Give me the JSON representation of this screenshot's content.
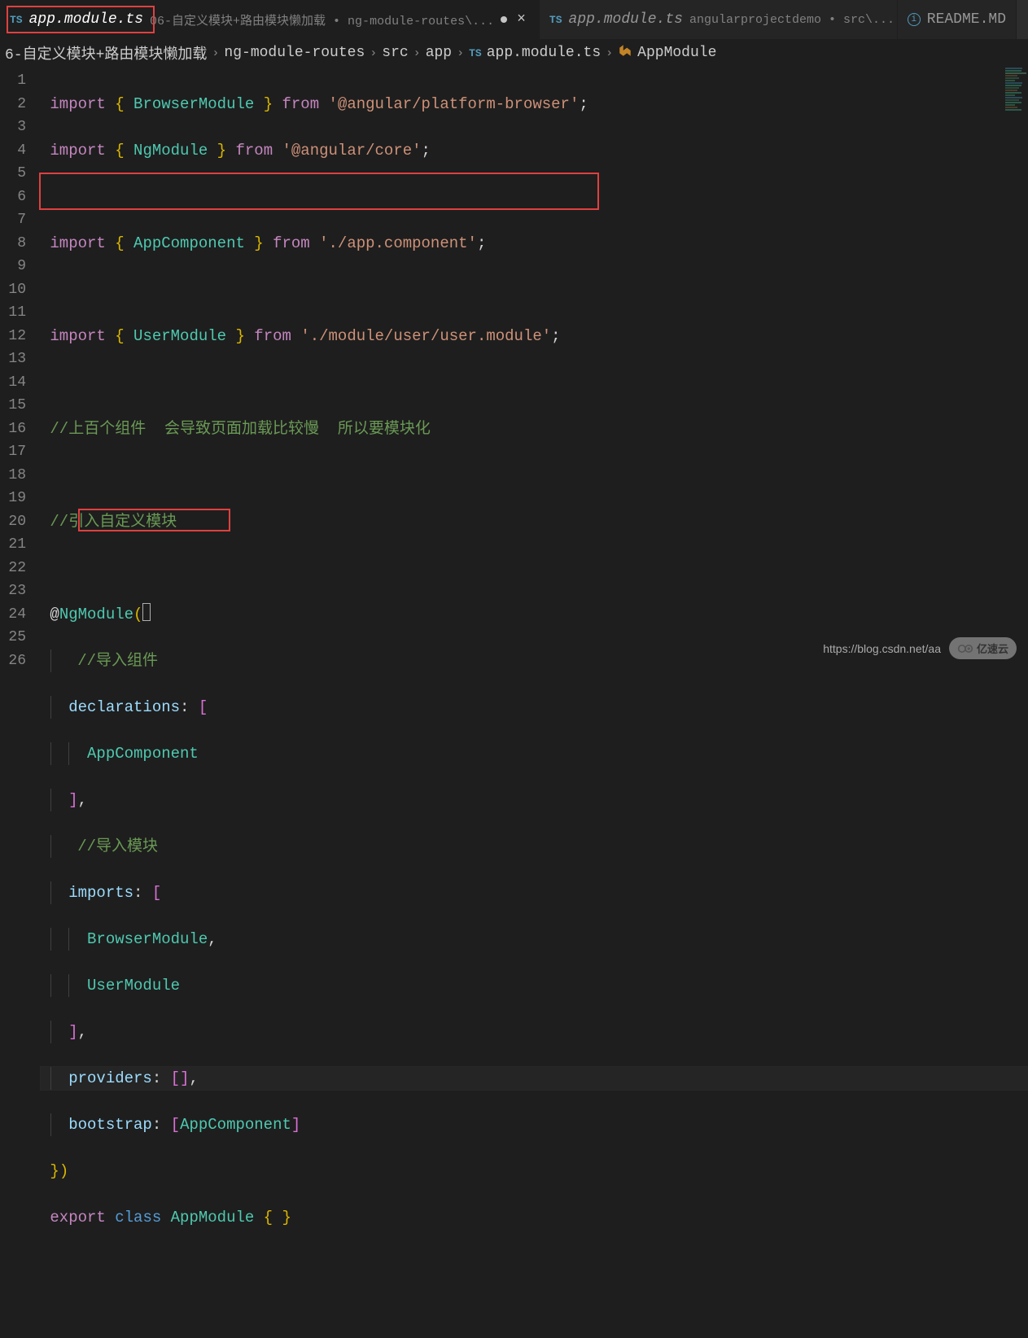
{
  "tabs": [
    {
      "file": "app.module.ts",
      "path": "06-自定义模块+路由模块懒加载 • ng-module-routes\\...",
      "active": true,
      "dirty": true,
      "icon": "ts"
    },
    {
      "file": "app.module.ts",
      "path": "angularprojectdemo • src\\...",
      "active": false,
      "dirty": false,
      "icon": "ts"
    },
    {
      "file": "README.MD",
      "path": "",
      "active": false,
      "dirty": false,
      "icon": "info"
    }
  ],
  "breadcrumbs": {
    "parts": [
      "6-自定义模块+路由模块懒加载",
      "ng-module-routes",
      "src",
      "app"
    ],
    "file": "app.module.ts",
    "symbol": "AppModule"
  },
  "code": {
    "lines": 26,
    "l1": {
      "kw": "import",
      "lb": "{",
      "t": "BrowserModule",
      "rb": "}",
      "from": "from",
      "s": "'@angular/platform-browser'",
      "end": ";"
    },
    "l2": {
      "kw": "import",
      "lb": "{",
      "t": "NgModule",
      "rb": "}",
      "from": "from",
      "s": "'@angular/core'",
      "end": ";"
    },
    "l4": {
      "kw": "import",
      "lb": "{",
      "t": "AppComponent",
      "rb": "}",
      "from": "from",
      "s": "'./app.component'",
      "end": ";"
    },
    "l6": {
      "kw": "import",
      "lb": "{",
      "t": "UserModule",
      "rb": "}",
      "from": "from",
      "s": "'./module/user/user.module'",
      "end": ";"
    },
    "l8": "//上百个组件  会导致页面加载比较慢  所以要模块化",
    "l10": "//引入自定义模块",
    "l12": {
      "at": "@",
      "dec": "NgModule",
      "lp": "("
    },
    "l13": "  //导入组件",
    "l14": {
      "prop": "declarations",
      "col": ":",
      "lb": " ["
    },
    "l15": "AppComponent",
    "l16": "],",
    "l17": "  //导入模块",
    "l18": {
      "prop": "imports",
      "col": ":",
      "lb": " ["
    },
    "l19": {
      "t": "BrowserModule",
      "c": ","
    },
    "l20": "UserModule",
    "l21": "],",
    "l22": {
      "prop": "providers",
      "col": ":",
      "lb": " [",
      "rb": "]",
      "c": ","
    },
    "l23": {
      "prop": "bootstrap",
      "col": ":",
      "lb": " [",
      "t": "AppComponent",
      "rb": "]"
    },
    "l24": "})",
    "l25": {
      "exp": "export",
      "cls": "class",
      "name": "AppModule",
      "lb": " { ",
      "rb": "}"
    }
  },
  "watermark": {
    "url": "https://blog.csdn.net/aa",
    "brand": "亿速云"
  }
}
